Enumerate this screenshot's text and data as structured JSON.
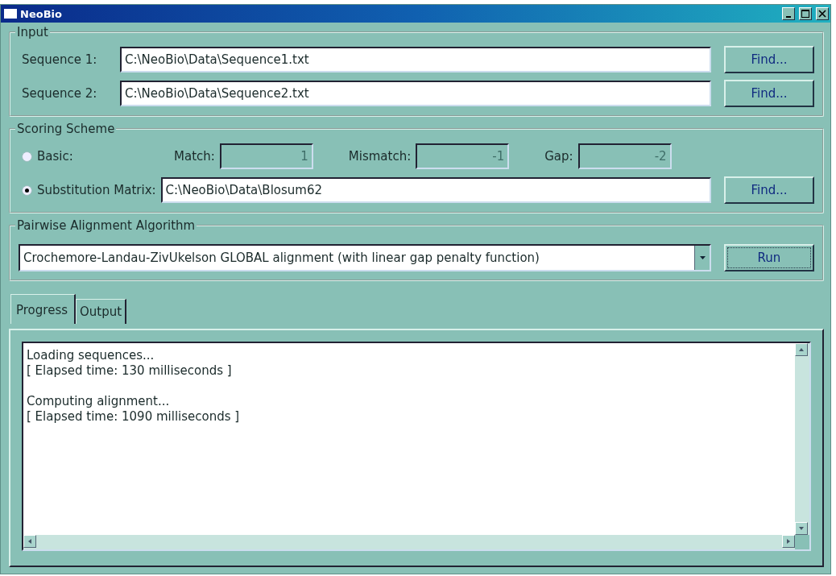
{
  "window": {
    "title": "NeoBio"
  },
  "input": {
    "title": "Input",
    "rows": [
      {
        "label": "Sequence 1:",
        "value": "C:\\NeoBio\\Data\\Sequence1.txt",
        "button": "Find..."
      },
      {
        "label": "Sequence 2:",
        "value": "C:\\NeoBio\\Data\\Sequence2.txt",
        "button": "Find..."
      }
    ]
  },
  "scoring": {
    "title": "Scoring Scheme",
    "basic": {
      "label": "Basic:",
      "selected": false,
      "fields": [
        {
          "label": "Match:",
          "value": "1",
          "disabled": true
        },
        {
          "label": "Mismatch:",
          "value": "-1",
          "disabled": true
        },
        {
          "label": "Gap:",
          "value": "-2",
          "disabled": true
        }
      ]
    },
    "matrix": {
      "label": "Substitution Matrix:",
      "selected": true,
      "value": "C:\\NeoBio\\Data\\Blosum62",
      "button": "Find..."
    }
  },
  "algorithm": {
    "title": "Pairwise Alignment Algorithm",
    "value": "Crochemore-Landau-ZivUkelson GLOBAL alignment (with linear gap penalty function)",
    "button": "Run",
    "button_focused": true
  },
  "tabs": [
    {
      "label": "Progress",
      "selected": true
    },
    {
      "label": "Output",
      "selected": false
    }
  ],
  "log": {
    "paragraphs": [
      [
        "Loading sequences...",
        "[ Elapsed time: 130 milliseconds ]"
      ],
      [
        "Computing alignment...",
        "[ Elapsed time: 1090 milliseconds ]"
      ]
    ]
  }
}
